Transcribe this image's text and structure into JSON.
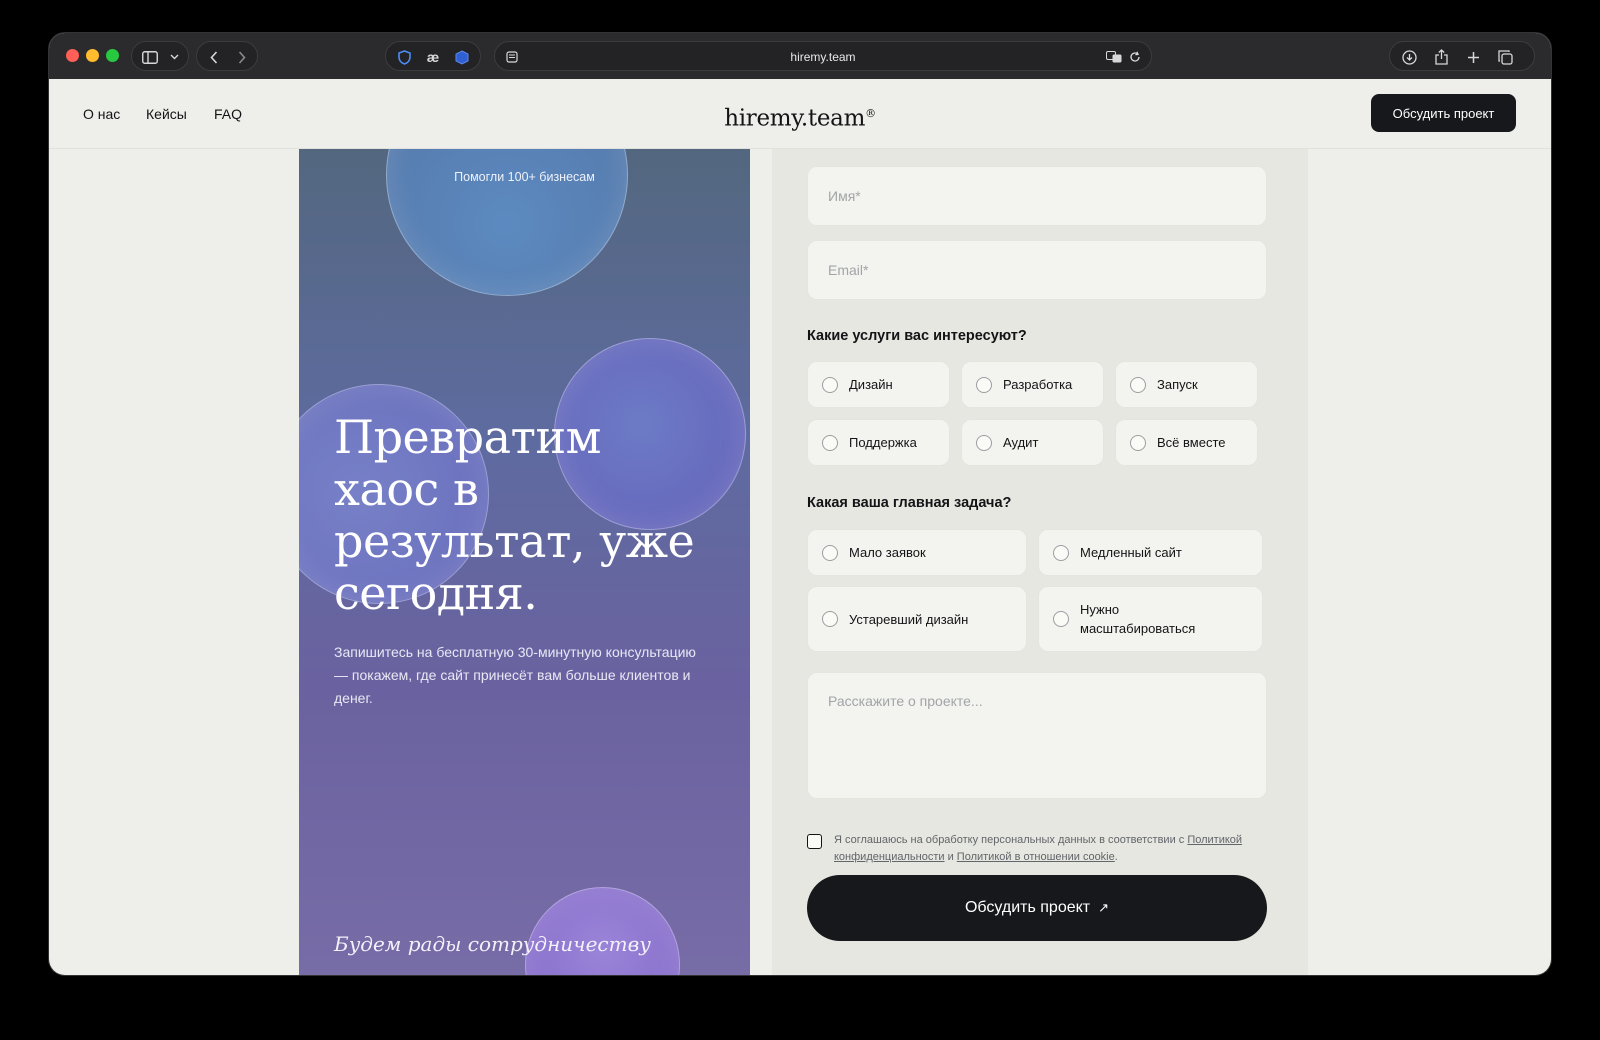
{
  "browser": {
    "url": "hiremy.team",
    "icons": [
      "sidebar-icon",
      "chevron-down-icon",
      "back-icon",
      "forward-icon",
      "shield-extension-icon",
      "ae-extension-icon",
      "cube-extension-icon",
      "reader-icon",
      "translate-icon",
      "reload-icon",
      "download-icon",
      "share-icon",
      "new-tab-icon",
      "tabs-overview-icon"
    ]
  },
  "header": {
    "nav": [
      "О нас",
      "Кейсы",
      "FAQ"
    ],
    "logo": "hiremy.team",
    "logo_mark": "®",
    "cta": "Обсудить проект"
  },
  "hero": {
    "tag": "Помогли 100+ бизнесам",
    "title": "Превратим хаос в результат, уже сегодня.",
    "subtitle": "Запишитесь на бесплатную 30-минутную консультацию — покажем, где сайт принесёт вам больше клиентов и денег.",
    "footer": "Будем рады сотрудничеству"
  },
  "form": {
    "name_placeholder": "Имя*",
    "email_placeholder": "Email*",
    "services_label": "Какие услуги вас интересуют?",
    "services": [
      "Дизайн",
      "Разработка",
      "Запуск",
      "Поддержка",
      "Аудит",
      "Всё вместе"
    ],
    "task_label": "Какая ваша главная задача?",
    "tasks": [
      "Мало заявок",
      "Медленный сайт",
      "Устаревший дизайн",
      "Нужно масштабироваться"
    ],
    "message_placeholder": "Расскажите о проекте...",
    "consent_prefix": "Я соглашаюсь на обработку персональных данных в соответствии с ",
    "consent_link1": "Политикой конфиденциальности",
    "consent_and": " и ",
    "consent_link2": "Политикой в отношении cookie",
    "consent_suffix": ".",
    "submit": "Обсудить проект",
    "submit_arrow": "↗"
  },
  "colors": {
    "accent_dark": "#17181c",
    "page_bg": "#eeefea",
    "hero_top": "#53677f",
    "hero_bottom": "#776ca6"
  }
}
